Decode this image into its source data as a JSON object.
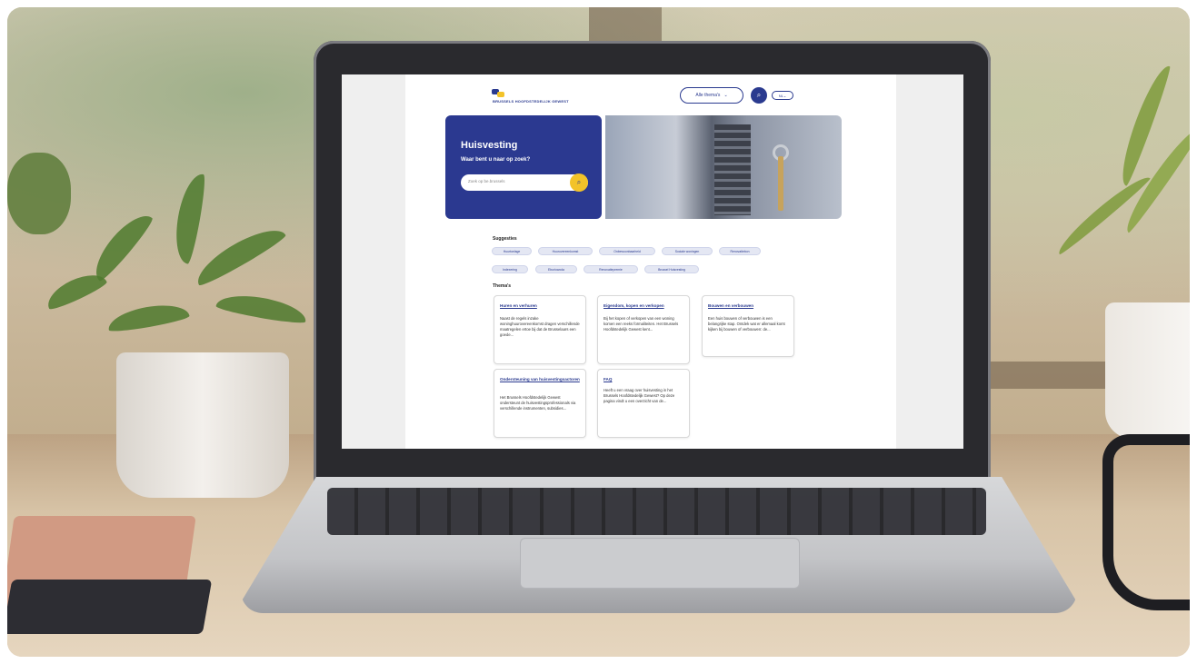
{
  "site": {
    "logo_text": "BRUSSELS HOOFDSTEDELIJK GEWEST",
    "themes_button": "Alle thema's",
    "lang_button": "NL",
    "hero": {
      "title": "Huisvesting",
      "subtitle": "Waar bent u naar op zoek?",
      "search_placeholder": "Zoek op be.brussels"
    },
    "suggestions": {
      "title": "Suggesties",
      "items": [
        "Huurtoelage",
        "Huurovereenkomst",
        "Onbewoonbaarheid",
        "Sociale woningen",
        "Renovatiebon",
        "Indexering",
        "Eburiowoda",
        "Renovatiepremie",
        "Brussel Huisvesting"
      ]
    },
    "themes": {
      "title": "Thema's",
      "cards": [
        {
          "title": "Huren en verhuren",
          "text": "Naast de regels inzake woninghuurovereenkomst dragen verschillende maatregelen ertoe bij dat de Brusselaars een goede..."
        },
        {
          "title": "Eigendom, kopen en verkopen",
          "text": "Bij het kopen of verkopen van een woning komen een reeks formaliteiten. Het Brussels Hoofdstedelijk Gewest kent..."
        },
        {
          "title": "Bouwen en verbouwen",
          "text": "Een huis bouwen of verbouwen is een belangrijke stap. Ontdek wat er allemaal komt kijken bij bouwen of verbouwen: de..."
        },
        {
          "title": "Ondersteuning van huisvestingsactoren",
          "text": "Het Brussels Hoofdstedelijk Gewest ondersteunt de huisvestingsprofessionals via verschillende instrumenten, subsidies..."
        },
        {
          "title": "FAQ",
          "text": "Heeft u een vraag over huisvesting in het Brussels Hoofdstedelijk Gewest? Op deze pagina vindt u een overzicht van de..."
        }
      ]
    }
  },
  "icons": {
    "search": "search-icon",
    "chevron": "chevron-down-icon"
  },
  "colors": {
    "brand_blue": "#2b3990",
    "brand_yellow": "#f3c329"
  }
}
